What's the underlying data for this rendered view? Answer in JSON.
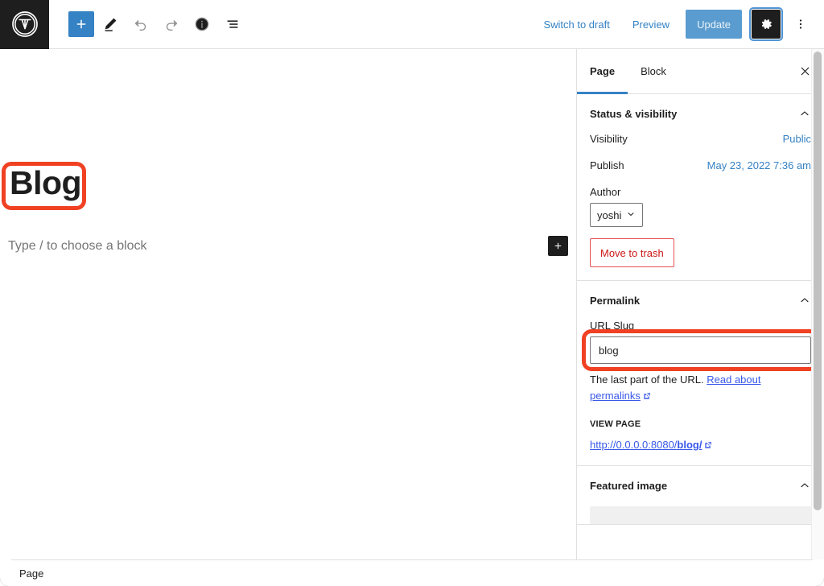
{
  "toolbar": {
    "logo_icon": "wordpress-logo-icon",
    "add_block_label": "+",
    "icons": [
      "edit-pencil-icon",
      "undo-icon",
      "redo-icon",
      "info-icon",
      "list-view-icon"
    ],
    "switch_to_draft_label": "Switch to draft",
    "preview_label": "Preview",
    "update_label": "Update",
    "settings_icon": "gear-icon",
    "options_icon": "kebab-menu-icon"
  },
  "editor": {
    "title": "Blog",
    "block_placeholder": "Type / to choose a block",
    "inserter_label": "+"
  },
  "sidebar": {
    "tabs": [
      {
        "label": "Page",
        "active": true
      },
      {
        "label": "Block",
        "active": false
      }
    ],
    "close_icon": "close-icon",
    "status": {
      "title": "Status & visibility",
      "visibility_label": "Visibility",
      "visibility_value": "Public",
      "publish_label": "Publish",
      "publish_value": "May 23, 2022 7:36 am",
      "author_label": "Author",
      "author_value": "yoshi",
      "trash_label": "Move to trash"
    },
    "permalink": {
      "title": "Permalink",
      "slug_label": "URL Slug",
      "slug_value": "blog",
      "slug_placeholder": "blog",
      "help_prefix": "The last part of the URL.",
      "help_link": "Read about permalinks",
      "view_page_label": "VIEW PAGE",
      "view_url_prefix": "http://0.0.0.0:8080/",
      "view_url_slug": "blog/"
    },
    "featured_image": {
      "title": "Featured image"
    }
  },
  "bottom_bar": {
    "label": "Page"
  },
  "colors": {
    "accent_blue": "#3582c4",
    "link_blue": "#3858e9",
    "annotation_orange": "#f04123",
    "danger_red": "#cc1818",
    "dark": "#1e1e1e"
  }
}
